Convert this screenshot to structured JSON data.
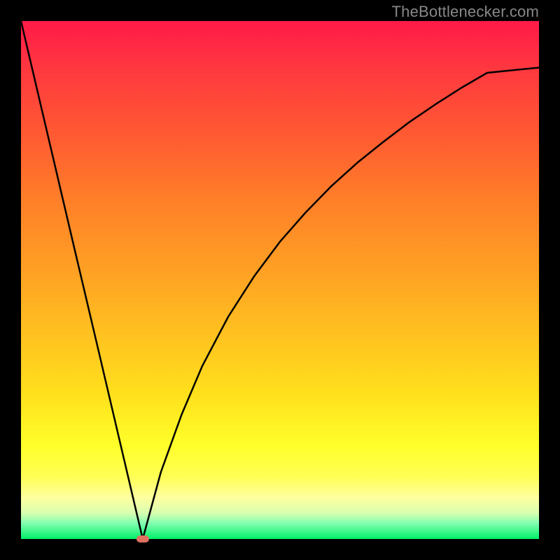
{
  "watermark": "TheBottlenecker.com",
  "chart_data": {
    "type": "line",
    "title": "",
    "xlabel": "",
    "ylabel": "",
    "xlim": [
      0,
      1
    ],
    "ylim": [
      0,
      1
    ],
    "vertex_x": 0.235,
    "curve_samples": [
      {
        "x": 0.0,
        "y": 1.0
      },
      {
        "x": 0.05,
        "y": 0.787
      },
      {
        "x": 0.1,
        "y": 0.574
      },
      {
        "x": 0.15,
        "y": 0.362
      },
      {
        "x": 0.2,
        "y": 0.149
      },
      {
        "x": 0.235,
        "y": 0.0
      },
      {
        "x": 0.27,
        "y": 0.129
      },
      {
        "x": 0.31,
        "y": 0.24
      },
      {
        "x": 0.35,
        "y": 0.334
      },
      {
        "x": 0.4,
        "y": 0.429
      },
      {
        "x": 0.45,
        "y": 0.507
      },
      {
        "x": 0.5,
        "y": 0.574
      },
      {
        "x": 0.55,
        "y": 0.631
      },
      {
        "x": 0.6,
        "y": 0.682
      },
      {
        "x": 0.65,
        "y": 0.727
      },
      {
        "x": 0.7,
        "y": 0.767
      },
      {
        "x": 0.75,
        "y": 0.805
      },
      {
        "x": 0.8,
        "y": 0.839
      },
      {
        "x": 0.85,
        "y": 0.871
      },
      {
        "x": 0.9,
        "y": 0.9
      },
      {
        "x": 0.95,
        "y": 0.905
      },
      {
        "x": 1.0,
        "y": 0.91
      }
    ],
    "marker": {
      "x": 0.235,
      "y": 0.0,
      "color": "#e07060"
    },
    "colors": {
      "curve": "#000000",
      "gradient_top": "#ff1a48",
      "gradient_bottom": "#00ef68"
    }
  }
}
